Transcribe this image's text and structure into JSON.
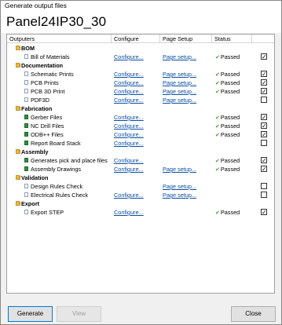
{
  "window": {
    "title": "Generate output files"
  },
  "heading": "Panel24IP30_30",
  "columns": {
    "outputers": "Outputers",
    "configure": "Configure",
    "page_setup": "Page Setup",
    "status": "Status"
  },
  "sections": [
    {
      "label": "BOM",
      "items": [
        {
          "label": "Bill of Materials",
          "icon": "document-icon",
          "configure": "Configure...",
          "page_setup": "Page setup...",
          "status": "Passed",
          "checked": true
        }
      ]
    },
    {
      "label": "Documentation",
      "items": [
        {
          "label": "Schematic Prints",
          "icon": "schematic-icon",
          "configure": "Configure...",
          "page_setup": "Page setup...",
          "status": "Passed",
          "checked": true
        },
        {
          "label": "PCB Prints",
          "icon": "pcb-icon",
          "configure": "Configure...",
          "page_setup": "Page setup...",
          "status": "Passed",
          "checked": true
        },
        {
          "label": "PCB 3D Print",
          "icon": "pcb-3d-icon",
          "configure": "Configure...",
          "page_setup": "Page setup...",
          "status": "Passed",
          "checked": true
        },
        {
          "label": "PDF3D",
          "icon": "pdf3d-icon",
          "configure": "Configure...",
          "page_setup": "Page setup...",
          "status": "",
          "checked": false
        }
      ]
    },
    {
      "label": "Fabrication",
      "items": [
        {
          "label": "Gerber Files",
          "icon": "gerber-icon",
          "configure": "Configure...",
          "page_setup": "",
          "status": "Passed",
          "checked": true
        },
        {
          "label": "NC Drill Files",
          "icon": "nc-drill-icon",
          "configure": "Configure...",
          "page_setup": "",
          "status": "Passed",
          "checked": true
        },
        {
          "label": "ODB++ Files",
          "icon": "odb-icon",
          "configure": "Configure...",
          "page_setup": "",
          "status": "Passed",
          "checked": true
        },
        {
          "label": "Report Board Stack",
          "icon": "report-icon",
          "configure": "Configure...",
          "page_setup": "",
          "status": "",
          "checked": false
        }
      ]
    },
    {
      "label": "Assembly",
      "items": [
        {
          "label": "Generates pick and place files",
          "icon": "pick-place-icon",
          "configure": "Configure...",
          "page_setup": "",
          "status": "Passed",
          "checked": true
        },
        {
          "label": "Assembly Drawings",
          "icon": "assembly-drawing-icon",
          "configure": "Configure...",
          "page_setup": "Page setup...",
          "status": "Passed",
          "checked": true
        }
      ]
    },
    {
      "label": "Validation",
      "items": [
        {
          "label": "Design Rules Check",
          "icon": "drc-icon",
          "configure": "",
          "page_setup": "Page setup...",
          "status": "",
          "checked": false
        },
        {
          "label": "Electrical Rules Check",
          "icon": "erc-icon",
          "configure": "Configure...",
          "page_setup": "Page setup...",
          "status": "",
          "checked": false
        }
      ]
    },
    {
      "label": "Export",
      "items": [
        {
          "label": "Export STEP",
          "icon": "step-export-icon",
          "configure": "Configure...",
          "page_setup": "",
          "status": "Passed",
          "checked": true
        }
      ]
    }
  ],
  "buttons": {
    "generate": "Generate",
    "view": "View",
    "close": "Close"
  },
  "colors": {
    "link": "#0b4ea2",
    "passed_tick": "#4a9a2a",
    "primary_button_border": "#0078d7"
  }
}
